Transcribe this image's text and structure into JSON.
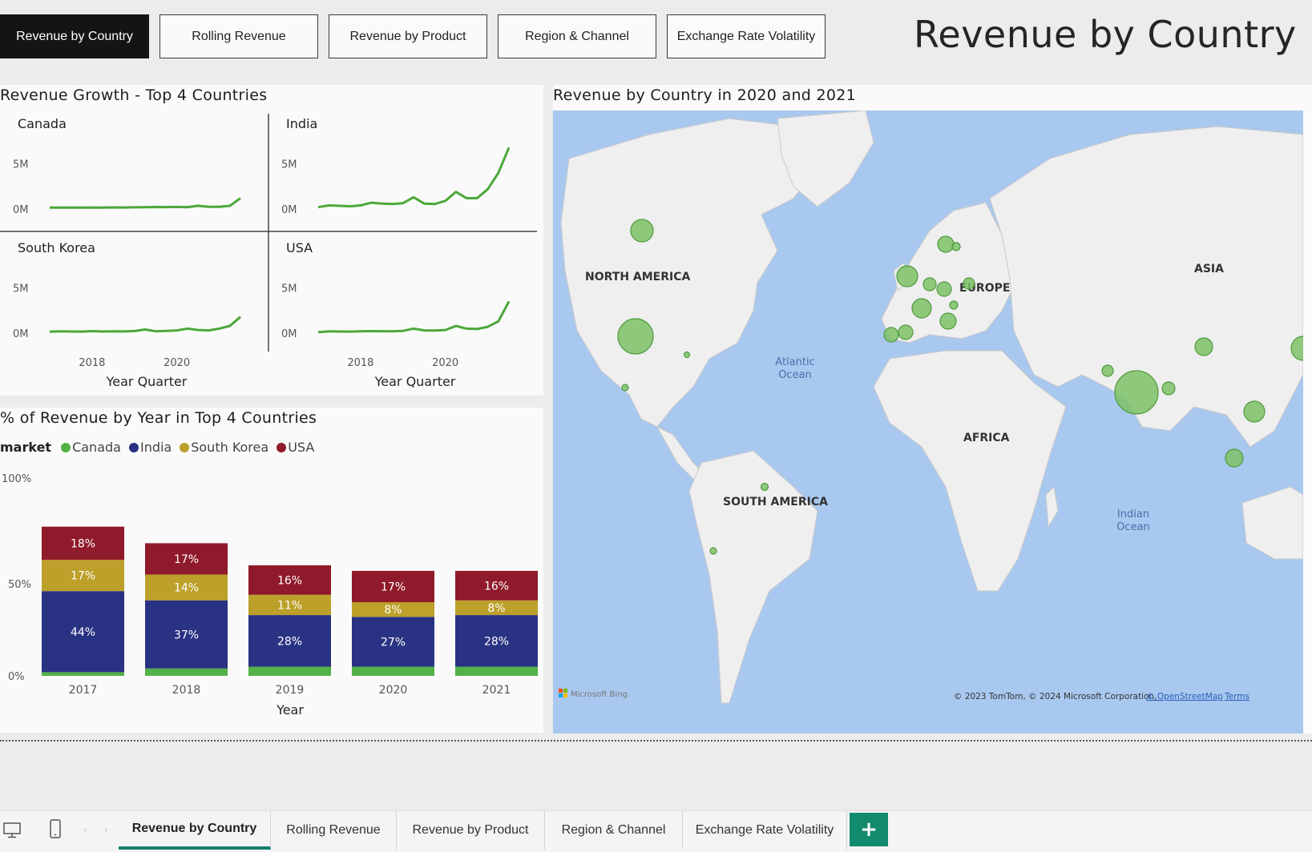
{
  "nav": {
    "buttons": [
      "Revenue by Country",
      "Rolling Revenue",
      "Revenue by Product",
      "Region & Channel",
      "Exchange Rate Volatility"
    ],
    "active_index": 0
  },
  "page_title": "Revenue by Country",
  "growth_panel": {
    "title": "Revenue Growth - Top 4 Countries",
    "x_axis_title": "Year Quarter",
    "y_ticks": [
      "5M",
      "0M"
    ],
    "x_ticks": [
      "2018",
      "2020"
    ],
    "line_color": "#4ca83a"
  },
  "chart_data": [
    {
      "type": "line",
      "title": "Canada",
      "xlabel": "Year Quarter",
      "x_ticks": [
        "2018",
        "2020"
      ],
      "y_ticks": [
        "5M",
        "0M"
      ],
      "ylim": [
        0,
        7000000
      ],
      "series": [
        {
          "values": [
            150000,
            150000,
            160000,
            150000,
            170000,
            160000,
            180000,
            170000,
            190000,
            200000,
            220000,
            210000,
            230000,
            200000,
            350000,
            250000,
            250000,
            350000,
            1200000
          ]
        }
      ]
    },
    {
      "type": "line",
      "title": "India",
      "xlabel": "Year Quarter",
      "x_ticks": [
        "2018",
        "2020"
      ],
      "y_ticks": [
        "5M",
        "0M"
      ],
      "ylim": [
        0,
        7000000
      ],
      "series": [
        {
          "values": [
            200000,
            400000,
            350000,
            300000,
            400000,
            700000,
            600000,
            550000,
            650000,
            1300000,
            600000,
            550000,
            900000,
            1900000,
            1200000,
            1200000,
            2200000,
            4000000,
            6800000
          ]
        }
      ]
    },
    {
      "type": "line",
      "title": "South Korea",
      "xlabel": "Year Quarter",
      "x_ticks": [
        "2018",
        "2020"
      ],
      "y_ticks": [
        "5M",
        "0M"
      ],
      "ylim": [
        0,
        7000000
      ],
      "series": [
        {
          "values": [
            150000,
            200000,
            180000,
            170000,
            220000,
            180000,
            200000,
            190000,
            230000,
            400000,
            200000,
            250000,
            300000,
            500000,
            350000,
            300000,
            500000,
            800000,
            1800000
          ]
        }
      ]
    },
    {
      "type": "line",
      "title": "USA",
      "xlabel": "Year Quarter",
      "x_ticks": [
        "2018",
        "2020"
      ],
      "y_ticks": [
        "5M",
        "0M"
      ],
      "ylim": [
        0,
        7000000
      ],
      "series": [
        {
          "values": [
            100000,
            200000,
            180000,
            170000,
            200000,
            220000,
            210000,
            200000,
            250000,
            500000,
            300000,
            280000,
            350000,
            800000,
            500000,
            450000,
            700000,
            1300000,
            3500000
          ]
        }
      ]
    },
    {
      "type": "bar",
      "stacked": true,
      "title": "% of Revenue by Year in Top 4 Countries",
      "xlabel": "Year",
      "categories": [
        "2017",
        "2018",
        "2019",
        "2020",
        "2021"
      ],
      "y_ticks": [
        "100%",
        "50%",
        "0%"
      ],
      "ylim": [
        0,
        100
      ],
      "series": [
        {
          "name": "Canada",
          "color": "#52b147",
          "values": [
            2,
            4,
            5,
            5,
            5
          ]
        },
        {
          "name": "India",
          "color": "#2a3283",
          "values": [
            44,
            37,
            28,
            27,
            28
          ]
        },
        {
          "name": "South Korea",
          "color": "#bda02a",
          "values": [
            17,
            14,
            11,
            8,
            8
          ]
        },
        {
          "name": "USA",
          "color": "#8f1a2b",
          "values": [
            18,
            17,
            16,
            17,
            16
          ]
        }
      ],
      "data_labels": [
        [
          "",
          "44%",
          "17%",
          "18%"
        ],
        [
          "",
          "37%",
          "14%",
          "17%"
        ],
        [
          "",
          "28%",
          "11%",
          "16%"
        ],
        [
          "",
          "27%",
          "8%",
          "17%"
        ],
        [
          "",
          "28%",
          "8%",
          "16%"
        ]
      ]
    }
  ],
  "legend": {
    "title": "market",
    "items": [
      "Canada",
      "India",
      "South Korea",
      "USA"
    ]
  },
  "map_panel": {
    "title": "Revenue by Country in 2020 and 2021",
    "labels": {
      "north_america": "NORTH AMERICA",
      "europe": "EUROPE",
      "asia": "ASIA",
      "africa": "AFRICA",
      "south_america": "SOUTH AMERICA",
      "atlantic_1": "Atlantic",
      "atlantic_2": "Ocean",
      "indian_1": "Indian",
      "indian_2": "Ocean"
    },
    "logo": "Microsoft Bing",
    "attribution": "© 2023 TomTom, © 2024 Microsoft Corporation,",
    "osm_link": "© OpenStreetMap",
    "terms_link": "Terms",
    "bubble_color": "#7cc266",
    "ocean_color": "#a9c8ef",
    "land_color": "#efefef"
  },
  "tabs": {
    "items": [
      "Revenue by Country",
      "Rolling Revenue",
      "Revenue by Product",
      "Region & Channel",
      "Exchange Rate Volatility"
    ],
    "active_index": 0,
    "add_label": "+"
  }
}
